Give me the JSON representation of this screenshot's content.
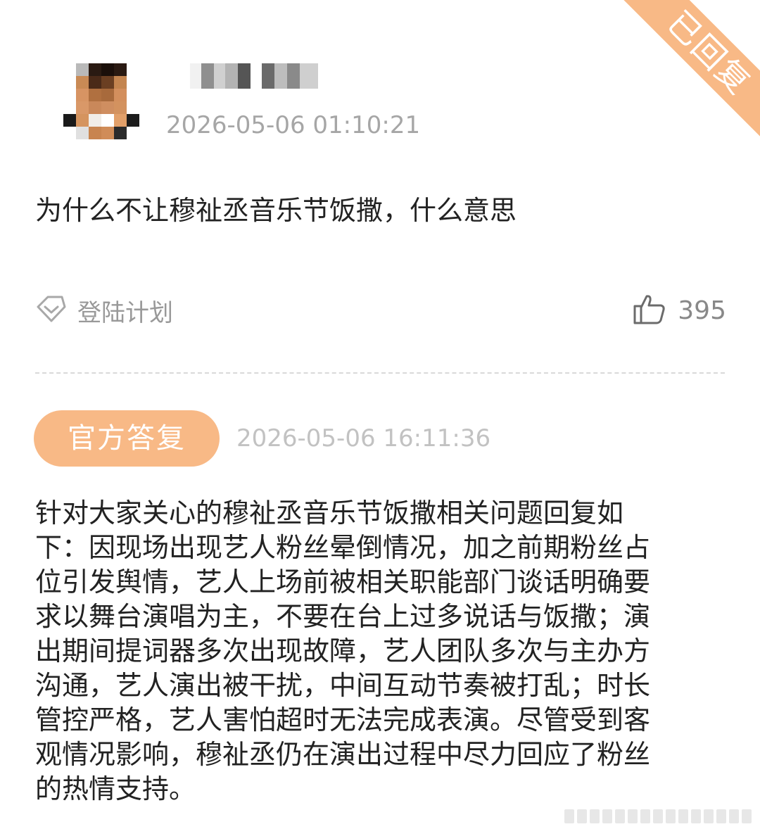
{
  "status_ribbon": "已回复",
  "asker": {
    "name_hidden": true,
    "timestamp": "2026-05-06 01:10:21"
  },
  "question": "为什么不让穆祉丞音乐节饭撒，什么意思",
  "topic": {
    "icon": "diamond-icon",
    "label": "登陆计划"
  },
  "likes": {
    "icon": "thumbs-up-icon",
    "count": "395"
  },
  "reply": {
    "badge": "官方答复",
    "timestamp": "2026-05-06 16:11:36",
    "lines": [
      "针对大家关心的穆祉丞音乐节饭撒相关问题回复如",
      "下：因现场出现艺人粉丝晕倒情况，加之前期粉丝占",
      "位引发舆情，艺人上场前被相关职能部门谈话明确要",
      "求以舞台演唱为主，不要在台上过多说话与饭撒；演",
      "出期间提词器多次出现故障，艺人团队多次与主办方",
      "沟通，艺人演出被干扰，中间互动节奏被打乱；时长",
      "管控严格，艺人害怕超时无法完成表演。尽管受到客",
      "观情况影响，穆祉丞仍在演出过程中尽力回应了粉丝",
      "的热情支持。"
    ]
  },
  "colors": {
    "accent": "#f8b986",
    "muted_text": "#a6a6a6",
    "body_text": "#222222"
  }
}
